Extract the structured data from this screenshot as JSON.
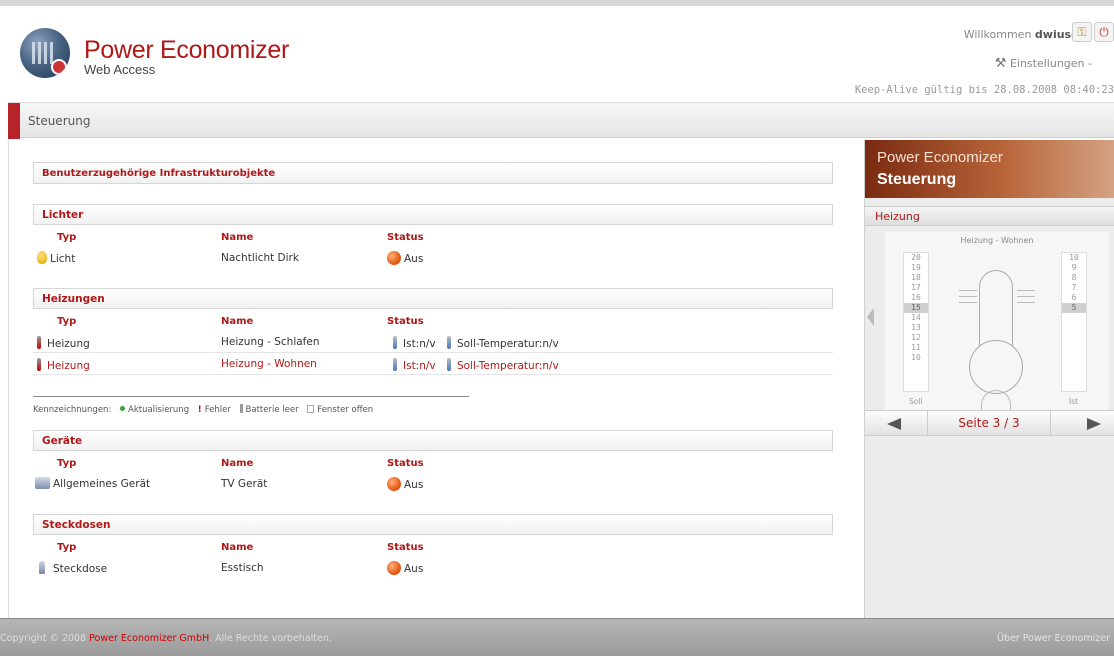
{
  "header": {
    "brand_title": "Power Economizer",
    "brand_sub": "Web Access",
    "welcome": "Willkommen",
    "username": "dwiuser",
    "settings": "Einstellungen -",
    "keepalive": "Keep-Alive gültig bis 28.08.2008 08:40:23"
  },
  "page": {
    "title": "Steuerung"
  },
  "main": {
    "title": "Benutzerzugehörige Infrastrukturobjekte",
    "cols": {
      "typ": "Typ",
      "name": "Name",
      "status": "Status"
    },
    "sections": {
      "lichter": {
        "title": "Lichter",
        "rows": [
          {
            "typ": "Licht",
            "name": "Nachtlicht Dirk",
            "status": "Aus"
          }
        ]
      },
      "heizungen": {
        "title": "Heizungen",
        "rows": [
          {
            "typ": "Heizung",
            "name": "Heizung - Schlafen",
            "ist": "Ist:n/v",
            "soll": "Soll-Temperatur:n/v"
          },
          {
            "typ": "Heizung",
            "name": "Heizung - Wohnen",
            "ist": "Ist:n/v",
            "soll": "Soll-Temperatur:n/v"
          }
        ]
      },
      "geraete": {
        "title": "Geräte",
        "rows": [
          {
            "typ": "Allgemeines Gerät",
            "name": "TV Gerät",
            "status": "Aus"
          }
        ]
      },
      "steckdosen": {
        "title": "Steckdosen",
        "rows": [
          {
            "typ": "Steckdose",
            "name": "Esstisch",
            "status": "Aus"
          }
        ]
      }
    },
    "legend": {
      "label": "Kennzeichnungen:",
      "items": [
        "Aktualisierung",
        "Fehler",
        "Batterie leer",
        "Fenster offen"
      ]
    }
  },
  "side": {
    "banner_line1": "Power Economizer",
    "banner_line2": "Steuerung",
    "subtitle": "Heizung",
    "widget_title": "Heizung - Wohnen",
    "soll_scale": [
      "20",
      "19",
      "18",
      "17",
      "16",
      "15",
      "14",
      "13",
      "12",
      "11",
      "10"
    ],
    "soll_selected": "15",
    "ist_scale": [
      "10",
      "9",
      "8",
      "7",
      "6",
      "5"
    ],
    "ist_selected": "5",
    "soll_label": "Soll",
    "ist_label": "Ist",
    "page": "Seite 3 / 3"
  },
  "footer": {
    "copy_prefix": "Copyright © 2008",
    "company": "Power Economizer GmbH",
    "copy_suffix": ". Alle Rechte vorbehalten.",
    "about": "Über Power Economizer"
  },
  "colors": {
    "accent": "#b01818",
    "banner": "#a0502a"
  }
}
